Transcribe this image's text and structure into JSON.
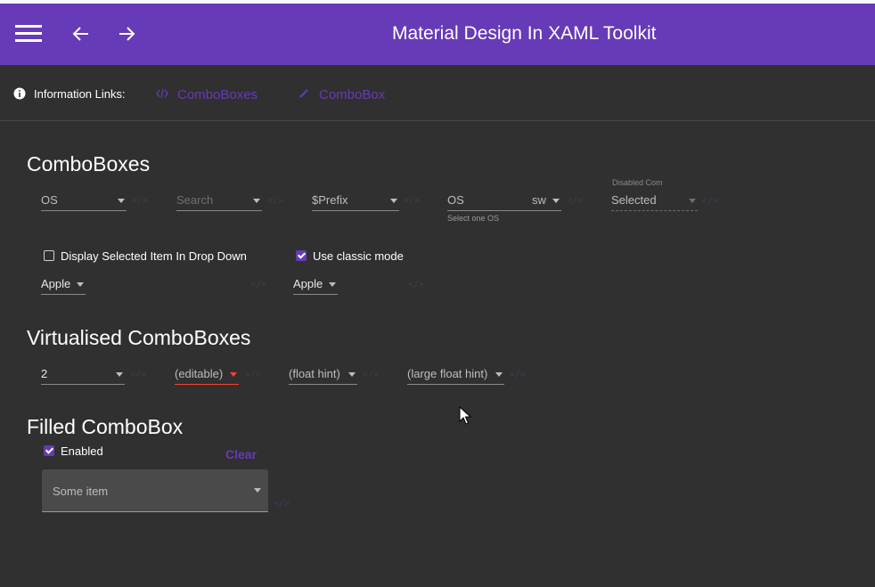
{
  "header": {
    "title": "Material Design In XAML Toolkit"
  },
  "info_links": {
    "label": "Information Links:",
    "links": [
      {
        "label": "ComboBoxes",
        "icon": "code-icon"
      },
      {
        "label": "ComboBox",
        "icon": "pencil-icon"
      }
    ]
  },
  "combo_section": {
    "title": "ComboBoxes",
    "combos": [
      {
        "value": "OS"
      },
      {
        "value": "Search"
      },
      {
        "value": "$Prefix"
      },
      {
        "value": "OS",
        "suffix": "sw",
        "helper": "Select one OS"
      },
      {
        "hint": "Disabled Com",
        "value": "Selected"
      }
    ],
    "display_selected_label": "Display Selected Item In Drop Down",
    "classic_mode_label": "Use classic mode",
    "apple_left": "Apple",
    "apple_right": "Apple"
  },
  "virtualised": {
    "title": "Virtualised ComboBoxes",
    "combos": [
      "2",
      "(editable)",
      "(float hint)",
      "(large float hint)"
    ]
  },
  "filled": {
    "title": "Filled ComboBox",
    "enabled_label": "Enabled",
    "clear_label": "Clear",
    "value": "Some item"
  },
  "colors": {
    "primary": "#673ab7",
    "background": "#303030",
    "error": "#f44336"
  }
}
